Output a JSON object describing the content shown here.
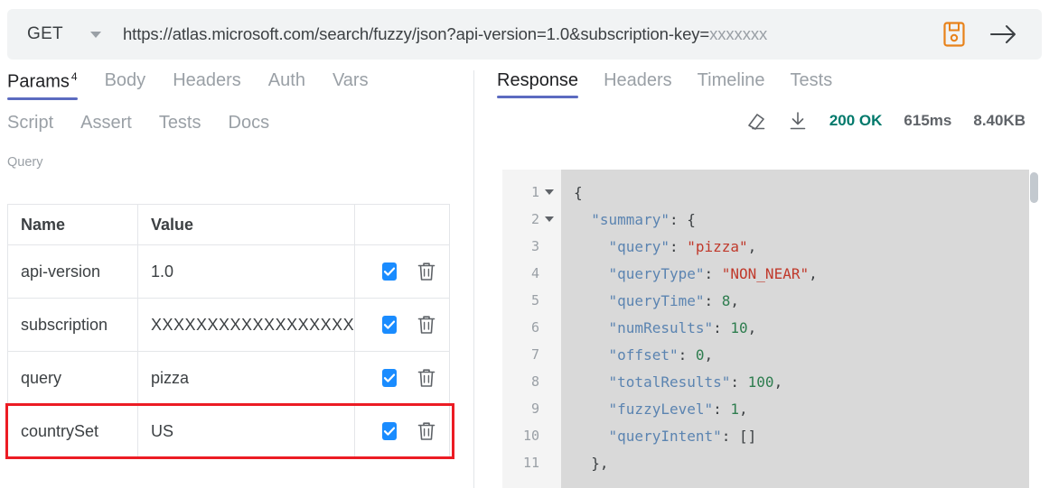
{
  "urlbar": {
    "method": "GET",
    "method_caret_icon": "chevron-down-icon",
    "url_visible": "https://atlas.microsoft.com/search/fuzzy/json?api-version=1.0&subscription-key=",
    "url_masked_suffix": "xxxxxxx",
    "save_icon": "save-floppy-icon",
    "send_icon": "arrow-right-icon",
    "save_icon_color": "#e8821a"
  },
  "request_tabs_row1": [
    {
      "label": "Params",
      "badge": "4",
      "active": true
    },
    {
      "label": "Body",
      "badge": "",
      "active": false
    },
    {
      "label": "Headers",
      "badge": "",
      "active": false
    },
    {
      "label": "Auth",
      "badge": "",
      "active": false
    },
    {
      "label": "Vars",
      "badge": "",
      "active": false
    }
  ],
  "request_tabs_row2": [
    {
      "label": "Script",
      "active": false
    },
    {
      "label": "Assert",
      "active": false
    },
    {
      "label": "Tests",
      "active": false
    },
    {
      "label": "Docs",
      "active": false
    }
  ],
  "params": {
    "section_label": "Query",
    "columns": [
      "Name",
      "Value",
      ""
    ],
    "rows": [
      {
        "name": "api-version",
        "value": "1.0",
        "masked": false,
        "enabled": true,
        "highlighted": false
      },
      {
        "name": "subscription",
        "value": "XXXXXXXXXXXXXXXXXX",
        "masked": true,
        "enabled": true,
        "highlighted": false
      },
      {
        "name": "query",
        "value": "pizza",
        "masked": false,
        "enabled": true,
        "highlighted": false
      },
      {
        "name": "countrySet",
        "value": "US",
        "masked": false,
        "enabled": true,
        "highlighted": true
      }
    ],
    "delete_icon": "trash-icon",
    "checkbox_color": "#1a8cff",
    "highlight_color": "#ec1c24"
  },
  "response_tabs": [
    {
      "label": "Response",
      "active": true
    },
    {
      "label": "Headers",
      "active": false
    },
    {
      "label": "Timeline",
      "active": false
    },
    {
      "label": "Tests",
      "active": false
    }
  ],
  "response_meta": {
    "clear_icon": "eraser-icon",
    "download_icon": "download-icon",
    "status": "200 OK",
    "status_color": "#00796b",
    "time": "615ms",
    "size": "8.40KB"
  },
  "code": {
    "lines": [
      {
        "no": "1",
        "foldable": true,
        "tokens": [
          {
            "t": "p",
            "v": "{"
          }
        ]
      },
      {
        "no": "2",
        "foldable": true,
        "tokens": [
          {
            "t": "p",
            "v": "  "
          },
          {
            "t": "k",
            "v": "\"summary\""
          },
          {
            "t": "p",
            "v": ": {"
          }
        ]
      },
      {
        "no": "3",
        "foldable": false,
        "tokens": [
          {
            "t": "p",
            "v": "    "
          },
          {
            "t": "k",
            "v": "\"query\""
          },
          {
            "t": "p",
            "v": ": "
          },
          {
            "t": "s",
            "v": "\"pizza\""
          },
          {
            "t": "p",
            "v": ","
          }
        ]
      },
      {
        "no": "4",
        "foldable": false,
        "tokens": [
          {
            "t": "p",
            "v": "    "
          },
          {
            "t": "k",
            "v": "\"queryType\""
          },
          {
            "t": "p",
            "v": ": "
          },
          {
            "t": "s",
            "v": "\"NON_NEAR\""
          },
          {
            "t": "p",
            "v": ","
          }
        ]
      },
      {
        "no": "5",
        "foldable": false,
        "tokens": [
          {
            "t": "p",
            "v": "    "
          },
          {
            "t": "k",
            "v": "\"queryTime\""
          },
          {
            "t": "p",
            "v": ": "
          },
          {
            "t": "n",
            "v": "8"
          },
          {
            "t": "p",
            "v": ","
          }
        ]
      },
      {
        "no": "6",
        "foldable": false,
        "tokens": [
          {
            "t": "p",
            "v": "    "
          },
          {
            "t": "k",
            "v": "\"numResults\""
          },
          {
            "t": "p",
            "v": ": "
          },
          {
            "t": "n",
            "v": "10"
          },
          {
            "t": "p",
            "v": ","
          }
        ]
      },
      {
        "no": "7",
        "foldable": false,
        "tokens": [
          {
            "t": "p",
            "v": "    "
          },
          {
            "t": "k",
            "v": "\"offset\""
          },
          {
            "t": "p",
            "v": ": "
          },
          {
            "t": "n",
            "v": "0"
          },
          {
            "t": "p",
            "v": ","
          }
        ]
      },
      {
        "no": "8",
        "foldable": false,
        "tokens": [
          {
            "t": "p",
            "v": "    "
          },
          {
            "t": "k",
            "v": "\"totalResults\""
          },
          {
            "t": "p",
            "v": ": "
          },
          {
            "t": "n",
            "v": "100"
          },
          {
            "t": "p",
            "v": ","
          }
        ]
      },
      {
        "no": "9",
        "foldable": false,
        "tokens": [
          {
            "t": "p",
            "v": "    "
          },
          {
            "t": "k",
            "v": "\"fuzzyLevel\""
          },
          {
            "t": "p",
            "v": ": "
          },
          {
            "t": "n",
            "v": "1"
          },
          {
            "t": "p",
            "v": ","
          }
        ]
      },
      {
        "no": "10",
        "foldable": false,
        "tokens": [
          {
            "t": "p",
            "v": "    "
          },
          {
            "t": "k",
            "v": "\"queryIntent\""
          },
          {
            "t": "p",
            "v": ": []"
          }
        ]
      },
      {
        "no": "11",
        "foldable": false,
        "tokens": [
          {
            "t": "p",
            "v": "  },"
          }
        ]
      }
    ]
  }
}
